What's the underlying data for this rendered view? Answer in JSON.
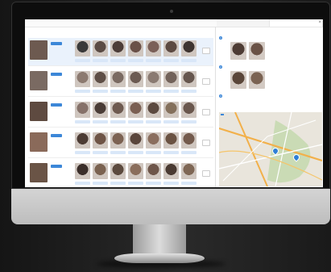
{
  "screen": {
    "breadcrumb": "",
    "left_panel": {
      "title": "",
      "actions": [
        "",
        "",
        "",
        ""
      ],
      "rows": [
        {
          "selected": true,
          "name": "",
          "sub": "",
          "main_tone": "#6d5a50",
          "faces": [
            "#3a3a3a",
            "#5a4b44",
            "#4c3d38",
            "#6a5148",
            "#7a6058",
            "#5c4a42",
            "#3e3430"
          ]
        },
        {
          "selected": false,
          "name": "",
          "sub": "",
          "main_tone": "#7a6a62",
          "faces": [
            "#8c7a70",
            "#5e4e46",
            "#7a6a62",
            "#6b5a52",
            "#8a7a72",
            "#72625a",
            "#66564e"
          ]
        },
        {
          "selected": false,
          "name": "",
          "sub": "",
          "main_tone": "#5e4a40",
          "faces": [
            "#86726a",
            "#4a3c36",
            "#6e5a50",
            "#7a5f52",
            "#5c4a40",
            "#84705c",
            "#6a574d"
          ]
        },
        {
          "selected": false,
          "name": "",
          "sub": "",
          "main_tone": "#8a6a5a",
          "faces": [
            "#4c3c34",
            "#6e5446",
            "#7c6252",
            "#5a463c",
            "#8a6e5e",
            "#6a5242",
            "#735a4c"
          ]
        },
        {
          "selected": false,
          "name": "",
          "sub": "",
          "main_tone": "#6a5446",
          "faces": [
            "#3a2e2a",
            "#7a6250",
            "#5c4a3e",
            "#8a6e5c",
            "#6e564a",
            "#4a3a32",
            "#7e6654"
          ]
        }
      ]
    },
    "right_panel": {
      "tabs": [
        "",
        ""
      ],
      "groups": [
        {
          "index": "1",
          "title": "",
          "faces": [
            "#4e3c34",
            "#6a5246"
          ]
        },
        {
          "index": "2",
          "title": "",
          "faces": [
            "#5a463a",
            "#7a6252"
          ]
        },
        {
          "index": "3",
          "title": "",
          "faces": []
        }
      ],
      "label_a": "",
      "label_b": "",
      "map_title": ""
    }
  },
  "colors": {
    "accent": "#3c87d8",
    "selected_row": "#eaf2fc"
  }
}
